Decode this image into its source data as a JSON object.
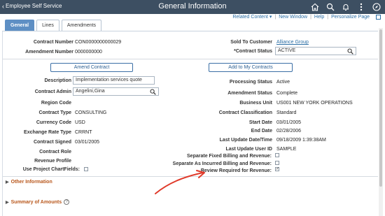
{
  "topbar": {
    "back_label": "Employee Self Service",
    "title": "General Information",
    "icons": [
      "home-icon",
      "search-icon",
      "bell-icon",
      "more-icon",
      "compass-icon"
    ]
  },
  "links": {
    "related": "Related Content ▾",
    "new_window": "New Window",
    "help": "Help",
    "personalize": "Personalize Page"
  },
  "tabs": [
    {
      "label": "General"
    },
    {
      "label": "Lines"
    },
    {
      "label": "Amendments"
    }
  ],
  "header": {
    "contract_number_label": "Contract Number",
    "contract_number": "CON0000000000029",
    "amendment_number_label": "Amendment Number",
    "amendment_number": "0000000000",
    "sold_to_label": "Sold To Customer",
    "sold_to": "Alliance Group",
    "contract_status_label": "*Contract Status",
    "contract_status": "ACTIVE"
  },
  "buttons": {
    "amend": "Amend Contract",
    "add_to_my": "Add to My Contracts"
  },
  "left": {
    "description_label": "Description",
    "description": "Implementation services quote",
    "admin_label": "Contract Admin",
    "admin": "Angelini,Gina",
    "region_label": "Region Code",
    "region": "",
    "type_label": "Contract Type",
    "type": "CONSULTING",
    "currency_label": "Currency Code",
    "currency": "USD",
    "exchange_label": "Exchange Rate Type",
    "exchange": "CRRNT",
    "signed_label": "Contract Signed",
    "signed": "03/01/2005",
    "role_label": "Contract Role",
    "role": "",
    "revenue_label": "Revenue Profile",
    "revenue": "",
    "chartfields_label": "Use Project ChartFields:"
  },
  "right": {
    "processing_label": "Processing Status",
    "processing": "Active",
    "amendment_status_label": "Amendment Status",
    "amendment_status": "Complete",
    "business_unit_label": "Business Unit",
    "business_unit": "US001 NEW YORK OPERATIONS",
    "classification_label": "Contract Classification",
    "classification": "Standard",
    "start_label": "Start Date",
    "start": "03/01/2005",
    "end_label": "End Date",
    "end": "02/28/2006",
    "last_update_label": "Last Update Date/Time",
    "last_update": "09/18/2009  1:39:38AM",
    "last_user_label": "Last Update User ID",
    "last_user": "SAMPLE",
    "sep_fixed_label": "Separate Fixed Billing and Revenue:",
    "sep_incurred_label": "Separate As Incurred Billing and Revenue:",
    "review_label": "Review Required for Revenue:"
  },
  "checks": {
    "chartfields": false,
    "sep_fixed": false,
    "sep_incurred": false,
    "review": true
  },
  "sections": {
    "other": "Other Information",
    "summary": "Summary of Amounts"
  },
  "colors": {
    "topbar": "#3d4f62",
    "tab_active": "#5e8fc4",
    "section": "#b8561a",
    "annotation": "#e03a2a"
  }
}
